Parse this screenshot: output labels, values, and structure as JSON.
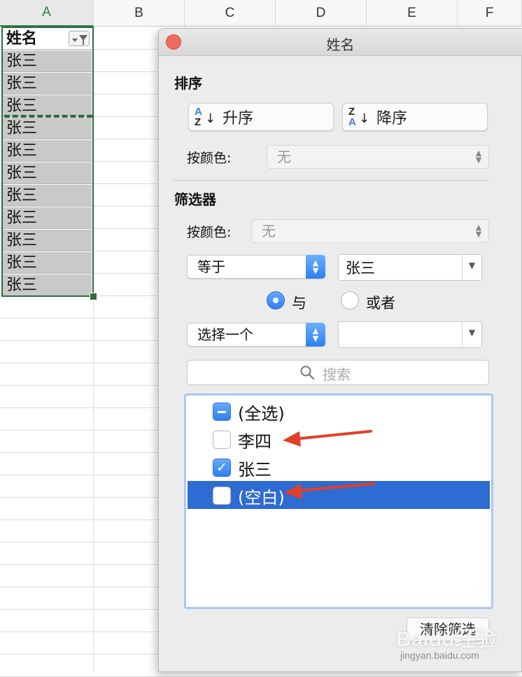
{
  "columns": [
    "A",
    "B",
    "C",
    "D",
    "E",
    "F"
  ],
  "column_a": {
    "header": "姓名",
    "values": [
      "张三",
      "张三",
      "张三",
      "张三",
      "张三",
      "张三",
      "张三",
      "张三",
      "张三",
      "张三",
      "张三"
    ]
  },
  "popup": {
    "title": "姓名",
    "sort": {
      "section": "排序",
      "asc_label": "升序",
      "asc_icon": [
        "A",
        "Z"
      ],
      "desc_label": "降序",
      "desc_icon": [
        "Z",
        "A"
      ],
      "by_color_label": "按颜色:",
      "by_color_value": "无"
    },
    "filter": {
      "section": "筛选器",
      "by_color_label": "按颜色:",
      "by_color_value": "无",
      "condition1": "等于",
      "value1": "张三",
      "and_label": "与",
      "or_label": "或者",
      "logic_selected": "and",
      "condition2": "选择一个",
      "value2": "",
      "search_placeholder": "搜索",
      "items": [
        {
          "label": "(全选)",
          "state": "mixed"
        },
        {
          "label": "李四",
          "state": "unchecked"
        },
        {
          "label": "张三",
          "state": "checked"
        },
        {
          "label": "(空白)",
          "state": "unchecked",
          "selected": true
        }
      ],
      "clear_label": "清除筛选"
    }
  },
  "watermark": {
    "text": "Baidu经验",
    "url": "jingyan.baidu.com"
  },
  "colors": {
    "selection": "#2f6b3f",
    "accent": "#2f7ff0",
    "highlight": "#2e6bd2",
    "annotation_arrow": "#e0402a"
  }
}
